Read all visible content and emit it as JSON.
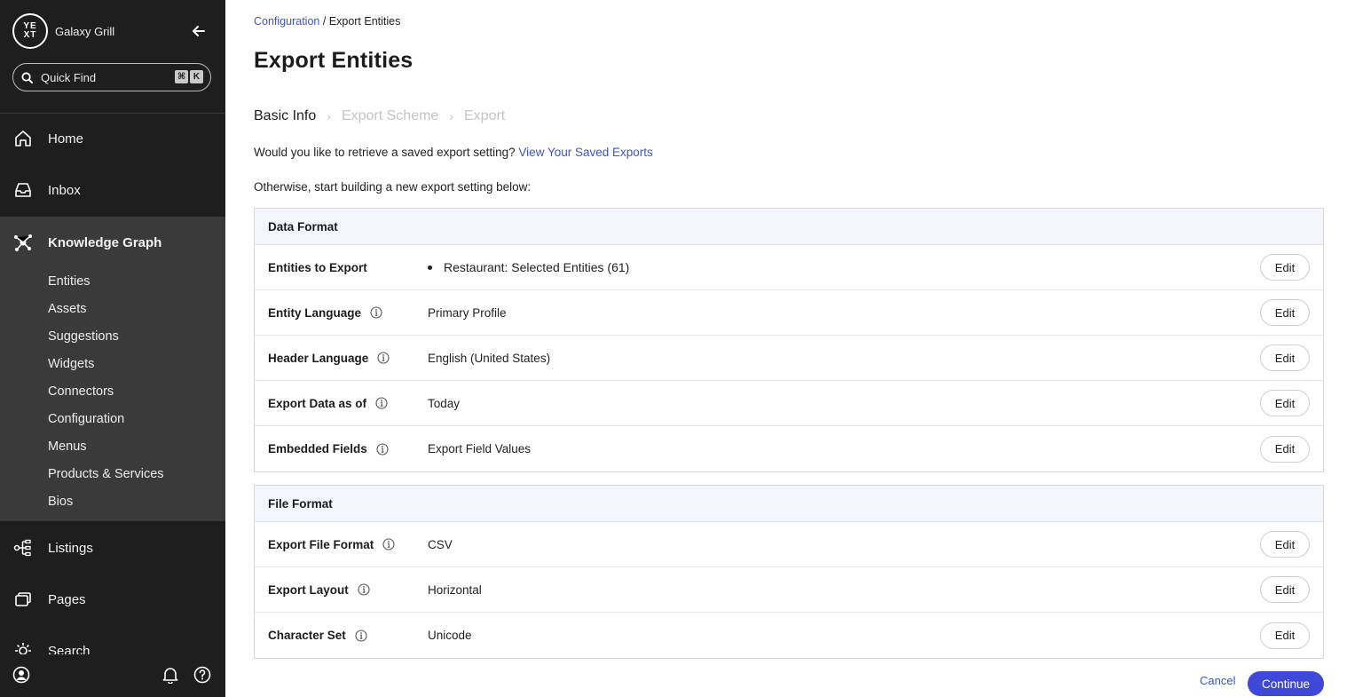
{
  "sidebar": {
    "brand": {
      "logo_text": "YE XT",
      "name": "Galaxy Grill"
    },
    "quick_find": {
      "label": "Quick Find",
      "shortcut": [
        "⌘",
        "K"
      ]
    },
    "nav": [
      {
        "label": "Home",
        "icon": "home-icon"
      },
      {
        "label": "Inbox",
        "icon": "inbox-icon"
      },
      {
        "label": "Knowledge Graph",
        "icon": "knowledge-graph-icon"
      },
      {
        "label": "Listings",
        "icon": "listings-icon"
      },
      {
        "label": "Pages",
        "icon": "pages-icon"
      },
      {
        "label": "Search",
        "icon": "search-sun-icon"
      }
    ],
    "kg_sub_items": [
      "Entities",
      "Assets",
      "Suggestions",
      "Widgets",
      "Connectors",
      "Configuration",
      "Menus",
      "Products & Services",
      "Bios"
    ],
    "footer_icons": [
      "account-icon",
      "bell-icon",
      "help-icon"
    ]
  },
  "breadcrumb": {
    "parent": "Configuration",
    "separator": " / ",
    "current": "Export Entities"
  },
  "page_title": "Export Entities",
  "steps": [
    {
      "label": "Basic Info",
      "current": true
    },
    {
      "label": "Export Scheme",
      "current": false
    },
    {
      "label": "Export",
      "current": false
    }
  ],
  "step_separator": "›",
  "retrieve": {
    "text": "Would you like to retrieve a saved export setting? ",
    "link": "View Your Saved Exports"
  },
  "otherwise_text": "Otherwise, start building a new export setting below:",
  "data_format": {
    "title": "Data Format",
    "rows": [
      {
        "label": "Entities to Export",
        "value": "Restaurant: Selected Entities (61)",
        "info": false,
        "bullet": true
      },
      {
        "label": "Entity Language",
        "value": "Primary Profile",
        "info": true
      },
      {
        "label": "Header Language",
        "value": "English (United States)",
        "info": true
      },
      {
        "label": "Export Data as of",
        "value": "Today",
        "info": true
      },
      {
        "label": "Embedded Fields",
        "value": "Export Field Values",
        "info": true
      }
    ]
  },
  "file_format": {
    "title": "File Format",
    "rows": [
      {
        "label": "Export File Format",
        "value": "CSV",
        "info": true
      },
      {
        "label": "Export Layout",
        "value": "Horizontal",
        "info": true
      },
      {
        "label": "Character Set",
        "value": "Unicode",
        "info": true
      }
    ]
  },
  "edit_label": "Edit",
  "actions": {
    "cancel": "Cancel",
    "continue": "Continue"
  },
  "colors": {
    "sidebar_bg": "#1e1e1e",
    "sidebar_active_bg": "#3a3a3a",
    "link": "#3a55d6",
    "primary_button": "#3f48d9",
    "panel_header_bg": "#f4f6fb"
  }
}
